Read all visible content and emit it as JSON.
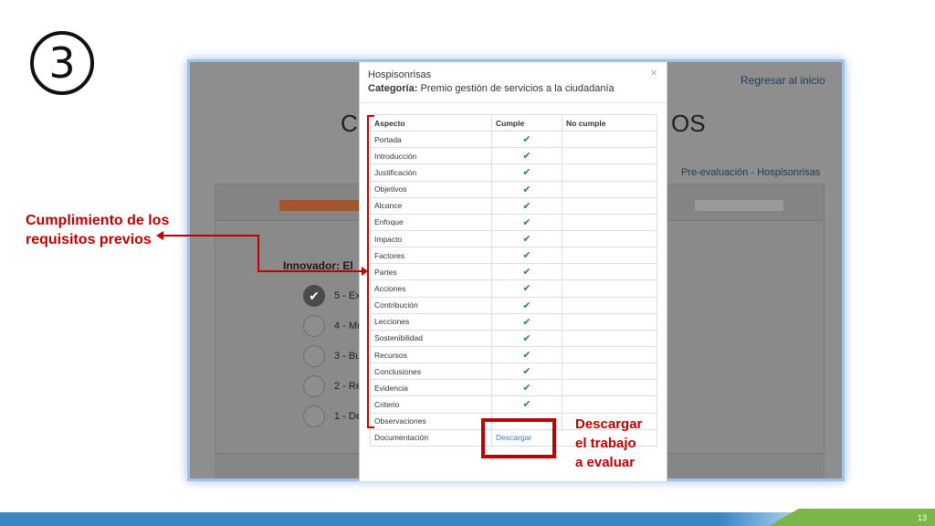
{
  "step_number": "3",
  "background": {
    "return_link": "Regresar al inicio",
    "title_left": "C",
    "title_right": "OS",
    "breadcrumb": "Pre-evaluación - Hospisonrisas",
    "criterion": "Innovador: El",
    "options": [
      {
        "label": "5 - Ex",
        "checked": true
      },
      {
        "label": "4 - Mu",
        "checked": false
      },
      {
        "label": "3 - Bu",
        "checked": false
      },
      {
        "label": "2 - Re",
        "checked": false
      },
      {
        "label": "1 - De",
        "checked": false
      }
    ]
  },
  "modal": {
    "title": "Hospisonrisas",
    "category_label": "Categoría:",
    "category_value": "Premio gestión de servicios a la ciudadanía",
    "close": "×",
    "columns": [
      "Aspecto",
      "Cumple",
      "No cumple"
    ],
    "rows": [
      {
        "aspect": "Portada",
        "cumple": "✔",
        "no_cumple": ""
      },
      {
        "aspect": "Introducción",
        "cumple": "✔",
        "no_cumple": ""
      },
      {
        "aspect": "Justificación",
        "cumple": "✔",
        "no_cumple": ""
      },
      {
        "aspect": "Objetivos",
        "cumple": "✔",
        "no_cumple": ""
      },
      {
        "aspect": "Alcance",
        "cumple": "✔",
        "no_cumple": ""
      },
      {
        "aspect": "Enfoque",
        "cumple": "✔",
        "no_cumple": ""
      },
      {
        "aspect": "Impacto",
        "cumple": "✔",
        "no_cumple": ""
      },
      {
        "aspect": "Factores",
        "cumple": "✔",
        "no_cumple": ""
      },
      {
        "aspect": "Partes",
        "cumple": "✔",
        "no_cumple": ""
      },
      {
        "aspect": "Acciones",
        "cumple": "✔",
        "no_cumple": ""
      },
      {
        "aspect": "Contribución",
        "cumple": "✔",
        "no_cumple": ""
      },
      {
        "aspect": "Lecciones",
        "cumple": "✔",
        "no_cumple": ""
      },
      {
        "aspect": "Sostenibilidad",
        "cumple": "✔",
        "no_cumple": ""
      },
      {
        "aspect": "Recursos",
        "cumple": "✔",
        "no_cumple": ""
      },
      {
        "aspect": "Conclusiones",
        "cumple": "✔",
        "no_cumple": ""
      },
      {
        "aspect": "Evidencia",
        "cumple": "✔",
        "no_cumple": ""
      },
      {
        "aspect": "Criterio",
        "cumple": "✔",
        "no_cumple": ""
      },
      {
        "aspect": "Observaciones",
        "cumple": "",
        "no_cumple": ""
      }
    ],
    "documentation_label": "Documentación",
    "download_link": "Descargar"
  },
  "annotations": {
    "requirements_line1": "Cumplimiento de los",
    "requirements_line2": "requisitos previos",
    "download_line1": "Descargar",
    "download_line2": "el trabajo",
    "download_line3": "a evaluar",
    "accent_color": "#c00000"
  },
  "slide_number": "13"
}
